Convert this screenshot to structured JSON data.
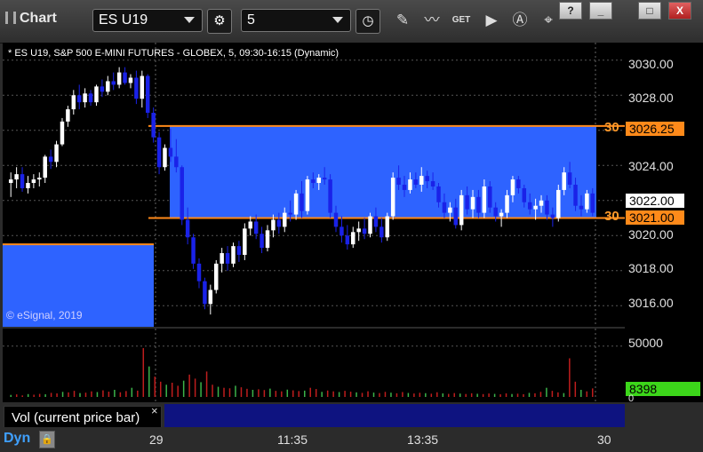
{
  "toolbar": {
    "title": "Chart",
    "symbol": "ES U19",
    "interval": "5",
    "icons": [
      "gear-icon",
      "clock-icon",
      "pencil-icon",
      "indicator-icon",
      "get-icon",
      "play-icon",
      "alert-icon",
      "drawing-tool-icon"
    ],
    "window_buttons": {
      "help": "?",
      "minimize": "_",
      "restore": "□",
      "close": "X"
    }
  },
  "chart_header": "* ES U19, S&P 500 E-MINI FUTURES - GLOBEX, 5, 09:30-16:15 (Dynamic)",
  "copyright": "© eSignal, 2019",
  "price_axis": {
    "ticks": [
      "3030.00",
      "3028.00",
      "3026.25",
      "3024.00",
      "3022.00",
      "3021.00",
      "3020.00",
      "3018.00",
      "3016.00"
    ],
    "label_3026": "3026.25",
    "label_3022": "3022.00",
    "label_3021": "3021.00",
    "tag_left_3026": "30",
    "tag_left_3021": "30"
  },
  "volume_axis": {
    "tick": "50000",
    "current": "8398",
    "zero": "0"
  },
  "time_axis": [
    "29",
    "11:35",
    "13:35",
    "30"
  ],
  "volume_label": "Vol (current price bar)",
  "volume_close": "×",
  "mode": "Dyn",
  "colors": {
    "up": "#ffffff",
    "down": "#1a22e8",
    "zone": "#2e63ff",
    "level": "#ff8a1a",
    "vol": "#bf1d1d",
    "volup": "#3bb44a"
  },
  "chart_data": {
    "type": "candlestick",
    "title": "ES U19, S&P 500 E-MINI FUTURES - GLOBEX, 5, 09:30-16:15 (Dynamic)",
    "ylim": [
      3014.8,
      3031.0
    ],
    "levels": [
      {
        "value": 3026.25
      },
      {
        "value": 3021.0
      }
    ],
    "prev_zone": {
      "value": 3019.5
    },
    "candles": [
      [
        3023.0,
        3023.6,
        3022.2,
        3023.2
      ],
      [
        3023.2,
        3023.9,
        3022.7,
        3023.5
      ],
      [
        3023.5,
        3023.9,
        3022.5,
        3022.7
      ],
      [
        3022.7,
        3023.4,
        3022.4,
        3023.0
      ],
      [
        3023.0,
        3023.5,
        3022.7,
        3023.2
      ],
      [
        3023.2,
        3023.6,
        3022.8,
        3023.3
      ],
      [
        3023.3,
        3024.6,
        3023.0,
        3024.5
      ],
      [
        3024.5,
        3024.9,
        3023.8,
        3024.2
      ],
      [
        3024.2,
        3025.4,
        3023.9,
        3025.2
      ],
      [
        3025.2,
        3026.7,
        3025.1,
        3026.5
      ],
      [
        3026.5,
        3027.4,
        3026.2,
        3027.2
      ],
      [
        3027.2,
        3028.3,
        3026.9,
        3028.0
      ],
      [
        3028.0,
        3028.6,
        3027.2,
        3027.6
      ],
      [
        3027.6,
        3028.4,
        3027.3,
        3028.1
      ],
      [
        3028.1,
        3028.3,
        3027.4,
        3027.6
      ],
      [
        3027.6,
        3028.6,
        3027.4,
        3028.5
      ],
      [
        3028.5,
        3028.9,
        3027.9,
        3028.2
      ],
      [
        3028.2,
        3029.1,
        3028.0,
        3028.8
      ],
      [
        3028.8,
        3029.3,
        3028.3,
        3028.6
      ],
      [
        3028.6,
        3029.6,
        3028.4,
        3029.3
      ],
      [
        3029.3,
        3029.6,
        3028.6,
        3028.7
      ],
      [
        3028.7,
        3029.2,
        3028.4,
        3029.0
      ],
      [
        3029.0,
        3029.4,
        3027.5,
        3027.8
      ],
      [
        3027.8,
        3029.4,
        3027.3,
        3029.1
      ],
      [
        3029.1,
        3029.2,
        3026.7,
        3027.0
      ],
      [
        3027.0,
        3027.3,
        3025.3,
        3025.6
      ],
      [
        3025.6,
        3025.9,
        3023.5,
        3023.9
      ],
      [
        3023.9,
        3025.2,
        3023.7,
        3025.0
      ],
      [
        3025.0,
        3026.1,
        3024.2,
        3024.5
      ],
      [
        3024.5,
        3025.5,
        3023.6,
        3023.9
      ],
      [
        3023.9,
        3024.0,
        3020.6,
        3020.9
      ],
      [
        3020.9,
        3021.6,
        3019.5,
        3019.9
      ],
      [
        3019.9,
        3020.1,
        3018.1,
        3018.4
      ],
      [
        3018.4,
        3018.7,
        3017.0,
        3017.4
      ],
      [
        3017.4,
        3017.6,
        3015.8,
        3016.1
      ],
      [
        3016.1,
        3017.2,
        3015.5,
        3016.9
      ],
      [
        3016.9,
        3018.6,
        3016.7,
        3018.4
      ],
      [
        3018.4,
        3019.3,
        3017.9,
        3019.0
      ],
      [
        3019.0,
        3019.4,
        3018.0,
        3018.4
      ],
      [
        3018.4,
        3019.6,
        3018.2,
        3019.4
      ],
      [
        3019.4,
        3019.7,
        3018.5,
        3018.9
      ],
      [
        3018.9,
        3020.7,
        3018.6,
        3020.4
      ],
      [
        3020.4,
        3021.1,
        3020.0,
        3020.8
      ],
      [
        3020.8,
        3021.2,
        3019.8,
        3020.1
      ],
      [
        3020.1,
        3020.5,
        3019.0,
        3019.3
      ],
      [
        3019.3,
        3020.6,
        3019.1,
        3020.3
      ],
      [
        3020.3,
        3021.2,
        3019.9,
        3020.9
      ],
      [
        3020.9,
        3021.3,
        3020.1,
        3020.5
      ],
      [
        3020.5,
        3021.6,
        3020.2,
        3021.3
      ],
      [
        3021.3,
        3022.0,
        3020.8,
        3021.2
      ],
      [
        3021.2,
        3022.6,
        3020.9,
        3022.4
      ],
      [
        3022.4,
        3023.1,
        3021.0,
        3021.4
      ],
      [
        3021.4,
        3023.4,
        3021.2,
        3023.2
      ],
      [
        3023.2,
        3023.6,
        3022.7,
        3023.0
      ],
      [
        3023.0,
        3023.5,
        3022.6,
        3023.3
      ],
      [
        3023.3,
        3023.9,
        3022.9,
        3023.2
      ],
      [
        3023.2,
        3023.5,
        3021.0,
        3021.3
      ],
      [
        3021.3,
        3021.7,
        3020.2,
        3020.5
      ],
      [
        3020.5,
        3021.1,
        3019.6,
        3020.0
      ],
      [
        3020.0,
        3020.6,
        3019.2,
        3019.5
      ],
      [
        3019.5,
        3020.5,
        3019.3,
        3020.2
      ],
      [
        3020.2,
        3020.8,
        3019.7,
        3020.4
      ],
      [
        3020.4,
        3021.0,
        3019.8,
        3020.1
      ],
      [
        3020.1,
        3021.3,
        3019.9,
        3021.1
      ],
      [
        3021.1,
        3021.6,
        3020.2,
        3020.5
      ],
      [
        3020.5,
        3021.0,
        3019.6,
        3019.9
      ],
      [
        3019.9,
        3021.3,
        3019.7,
        3021.1
      ],
      [
        3021.1,
        3023.6,
        3020.9,
        3023.3
      ],
      [
        3023.3,
        3024.0,
        3022.6,
        3022.9
      ],
      [
        3022.9,
        3023.4,
        3022.2,
        3022.6
      ],
      [
        3022.6,
        3023.6,
        3022.4,
        3023.2
      ],
      [
        3023.2,
        3023.6,
        3022.7,
        3022.9
      ],
      [
        3022.9,
        3023.9,
        3022.5,
        3023.4
      ],
      [
        3023.4,
        3023.7,
        3022.7,
        3023.1
      ],
      [
        3023.1,
        3023.6,
        3022.6,
        3022.8
      ],
      [
        3022.8,
        3023.0,
        3021.6,
        3021.9
      ],
      [
        3021.9,
        3022.4,
        3021.0,
        3021.3
      ],
      [
        3021.3,
        3021.9,
        3020.8,
        3021.6
      ],
      [
        3021.6,
        3022.1,
        3020.4,
        3020.6
      ],
      [
        3020.6,
        3022.6,
        3020.3,
        3022.3
      ],
      [
        3022.3,
        3022.8,
        3021.2,
        3021.5
      ],
      [
        3021.5,
        3022.6,
        3021.0,
        3022.2
      ],
      [
        3022.2,
        3022.6,
        3021.0,
        3021.3
      ],
      [
        3021.3,
        3023.2,
        3021.0,
        3022.8
      ],
      [
        3022.8,
        3023.1,
        3021.3,
        3021.6
      ],
      [
        3021.6,
        3021.9,
        3020.8,
        3021.1
      ],
      [
        3021.1,
        3021.5,
        3020.5,
        3021.3
      ],
      [
        3021.3,
        3022.6,
        3021.0,
        3022.3
      ],
      [
        3022.3,
        3023.4,
        3021.9,
        3023.2
      ],
      [
        3023.2,
        3023.4,
        3022.4,
        3022.7
      ],
      [
        3022.7,
        3022.9,
        3021.6,
        3021.9
      ],
      [
        3021.9,
        3022.4,
        3021.2,
        3021.5
      ],
      [
        3021.5,
        3022.1,
        3020.9,
        3021.7
      ],
      [
        3021.7,
        3022.3,
        3021.3,
        3022.0
      ],
      [
        3022.0,
        3022.3,
        3020.9,
        3021.2
      ],
      [
        3021.2,
        3021.6,
        3020.5,
        3021.0
      ],
      [
        3021.0,
        3022.9,
        3020.8,
        3022.6
      ],
      [
        3022.6,
        3023.9,
        3022.3,
        3023.6
      ],
      [
        3023.6,
        3024.2,
        3022.7,
        3022.9
      ],
      [
        3022.9,
        3023.3,
        3021.4,
        3021.7
      ],
      [
        3021.7,
        3022.3,
        3021.1,
        3021.5
      ],
      [
        3021.5,
        3022.6,
        3021.3,
        3022.4
      ],
      [
        3022.4,
        3022.7,
        3021.1,
        3021.3
      ]
    ],
    "volume": [
      2000,
      2500,
      1500,
      2800,
      2200,
      3000,
      2600,
      4000,
      3500,
      5000,
      4500,
      6000,
      3800,
      4200,
      5500,
      4800,
      6500,
      5200,
      7000,
      4600,
      5800,
      9000,
      6200,
      48000,
      30000,
      20000,
      15000,
      12000,
      14000,
      11000,
      16000,
      22000,
      18000,
      14500,
      25000,
      12000,
      10000,
      9000,
      8500,
      11000,
      9500,
      8000,
      7000,
      7500,
      6800,
      8200,
      6000,
      5500,
      7200,
      6500,
      5800,
      6200,
      9000,
      7800,
      5000,
      6300,
      5500,
      4800,
      6000,
      5200,
      4500,
      4000,
      5600,
      4300,
      3800,
      5000,
      4200,
      3600,
      4800,
      3900,
      3400,
      4100,
      3700,
      3200,
      4600,
      3500,
      3000,
      3800,
      3300,
      2900,
      3600,
      3100,
      2800,
      3400,
      3000,
      2600,
      3500,
      2900,
      3200,
      2700,
      4000,
      3600,
      5000,
      9000,
      6000,
      4500,
      3800,
      38000,
      15000,
      7000,
      5500,
      8398
    ],
    "volume_ylim": [
      0,
      62000
    ]
  }
}
